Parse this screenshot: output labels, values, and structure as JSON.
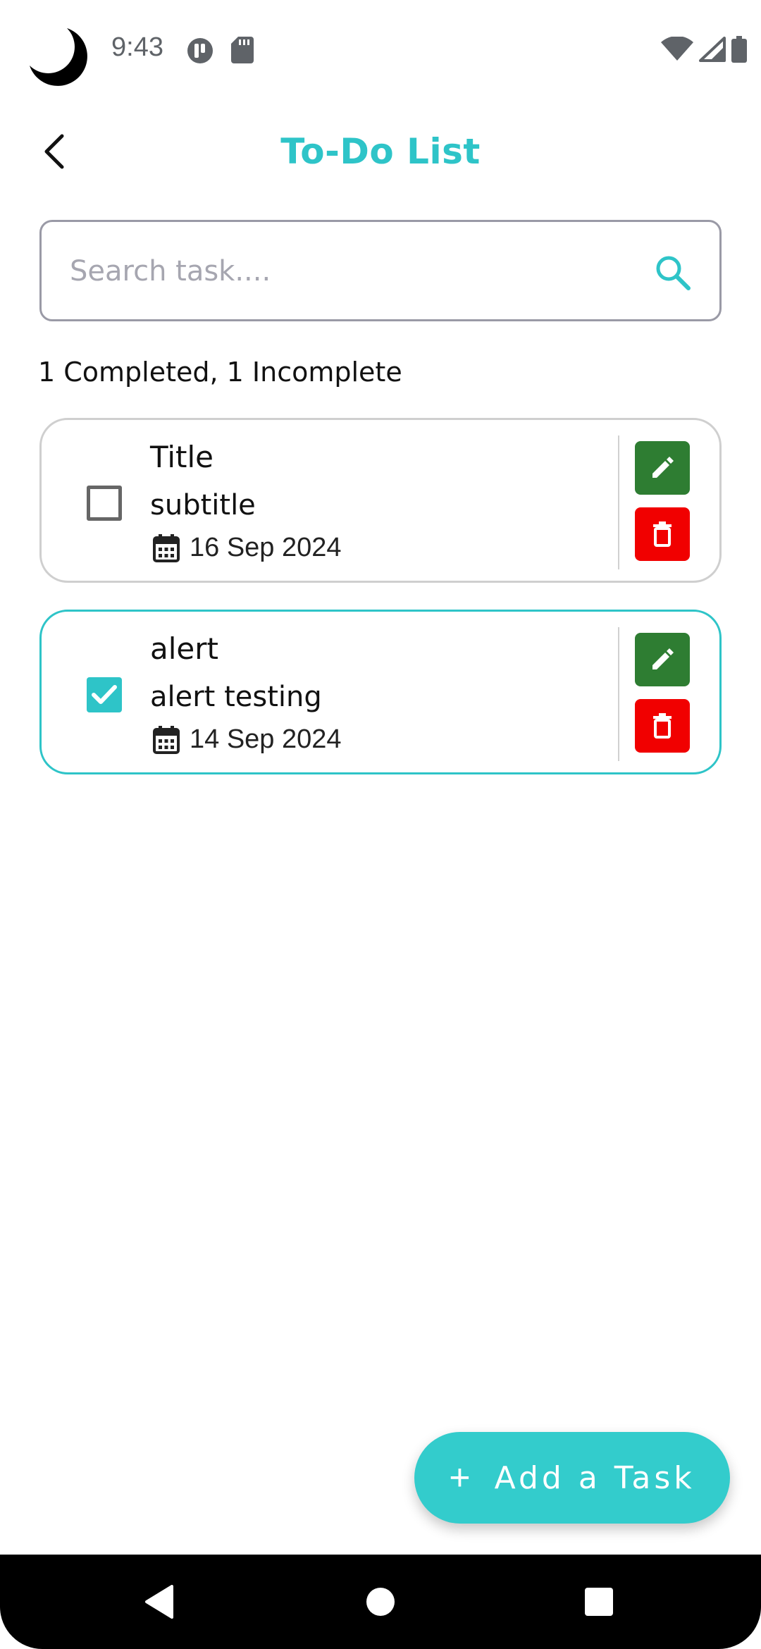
{
  "status_bar": {
    "time": "9:43",
    "icons": [
      "moon-icon",
      "notification-app-icon",
      "sd-card-icon",
      "wifi-icon",
      "signal-icon",
      "battery-icon"
    ]
  },
  "header": {
    "title": "To-Do List",
    "back_icon": "chevron-left-icon"
  },
  "search": {
    "placeholder": "Search task....",
    "value": "",
    "icon": "search-icon"
  },
  "summary": "1 Completed, 1 Incomplete",
  "tasks": [
    {
      "title": "Title",
      "subtitle": "subtitle",
      "date": "16 Sep 2024",
      "completed": false
    },
    {
      "title": "alert",
      "subtitle": "alert testing",
      "date": "14 Sep 2024",
      "completed": true
    }
  ],
  "fab": {
    "icon": "plus",
    "label": "Add a Task"
  },
  "nav_bar": {
    "buttons": [
      "back-icon",
      "home-icon",
      "recents-icon"
    ]
  },
  "colors": {
    "accent": "#2ec4c8",
    "edit": "#2e7d32",
    "delete": "#f10000",
    "fab": "#33cccc"
  }
}
